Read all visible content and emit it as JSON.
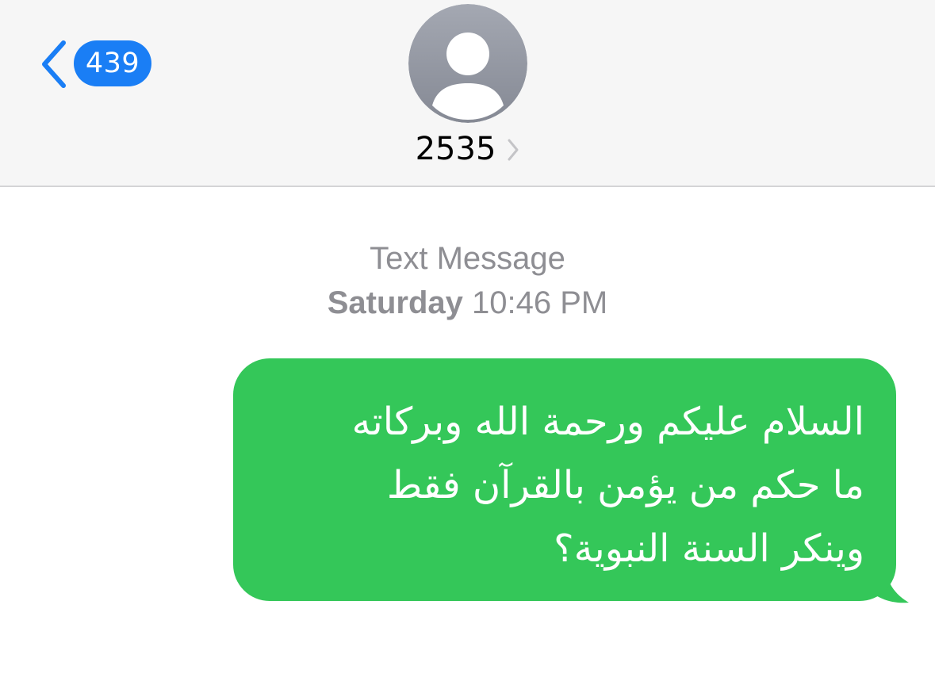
{
  "colors": {
    "accent_blue": "#1a7ef5",
    "message_green": "#34c759",
    "header_bg": "#f6f6f6",
    "avatar_grad_top": "#a4a8b2",
    "avatar_grad_bottom": "#858994",
    "secondary_text": "#8e8e93"
  },
  "header": {
    "back_icon": "chevron-left-icon",
    "unread_count": "439",
    "avatar_icon": "person-silhouette-icon",
    "contact_name": "2535",
    "details_icon": "chevron-right-icon"
  },
  "conversation": {
    "service": "Text Message",
    "day": "Saturday",
    "time": "10:46 PM",
    "messages": [
      {
        "direction": "outgoing",
        "lines": [
          "السلام عليكم ورحمة الله وبركاته",
          "ما حكم من يؤمن بالقرآن فقط",
          "وينكر السنة النبوية؟"
        ]
      }
    ]
  }
}
